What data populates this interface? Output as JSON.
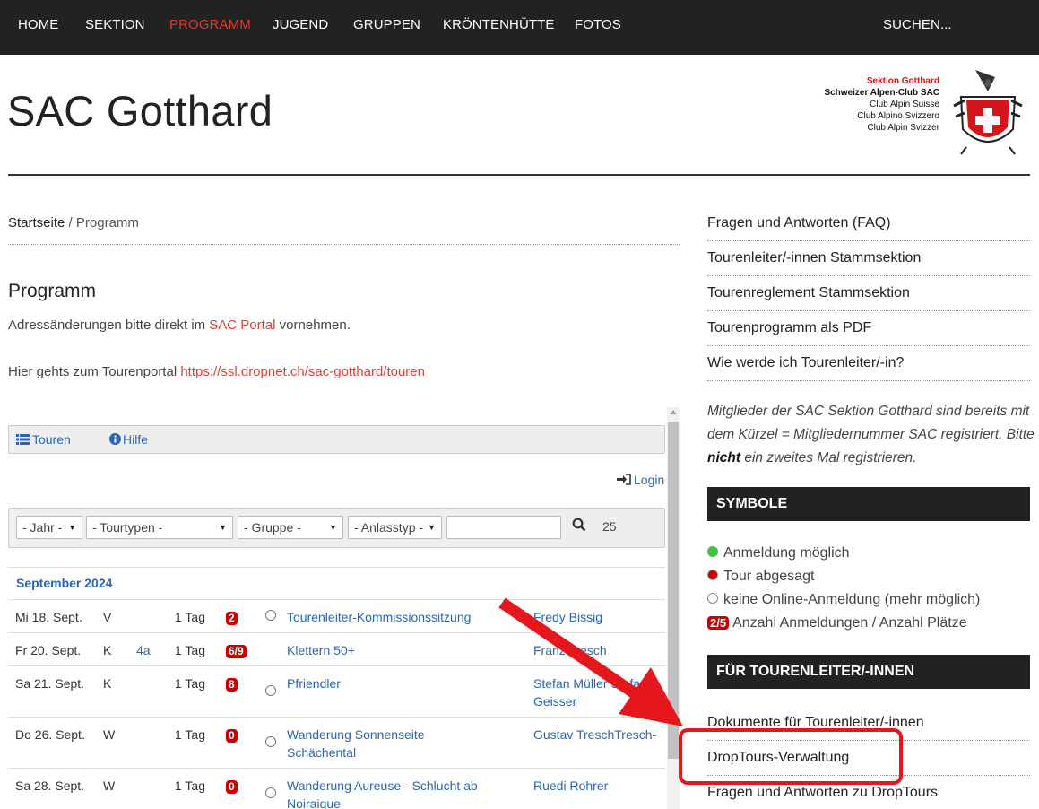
{
  "nav": {
    "items": [
      "HOME",
      "SEKTION",
      "PROGRAMM",
      "JUGEND",
      "GRUPPEN",
      "KRÖNTENHÜTTE",
      "FOTOS"
    ],
    "search": "SUCHEN..."
  },
  "header": {
    "title": "SAC Gotthard",
    "logo_lines": [
      "Sektion Gotthard",
      "Schweizer Alpen-Club SAC",
      "Club Alpin Suisse",
      "Club Alpino Svizzero",
      "Club Alpin Svizzer"
    ]
  },
  "breadcrumb": {
    "home": "Startseite",
    "sep": " / ",
    "current": "Programm"
  },
  "main": {
    "title": "Programm",
    "intro1_pre": "Adressänderungen bitte direkt im ",
    "intro1_link": "SAC Portal",
    "intro1_post": " vornehmen.",
    "intro2_pre": "Hier gehts zum Tourenportal ",
    "intro2_link": "https://ssl.dropnet.ch/sac-gotthard/touren"
  },
  "widget": {
    "tab_tours": "Touren",
    "tab_help": "Hilfe",
    "login": "Login",
    "filters": [
      "- Jahr -",
      "- Tourtypen -",
      "- Gruppe -",
      "- Anlasstyp -"
    ],
    "count": "25",
    "month": "September 2024",
    "rows": [
      {
        "date": "Mi 18. Sept.",
        "type": "V",
        "grade": "",
        "dur": "1 Tag",
        "badge": "2",
        "title": "Tourenleiter-Kommissionssitzung",
        "title2": "",
        "leader": "Fredy Bissig",
        "leader2": ""
      },
      {
        "date": "Fr 20. Sept.",
        "type": "K",
        "grade": "4a",
        "dur": "1 Tag",
        "badge": "6/9",
        "title": "Klettern 50+",
        "title2": "",
        "leader": "Franz Tresch",
        "leader2": ""
      },
      {
        "date": "Sa 21. Sept.",
        "type": "K",
        "grade": "",
        "dur": "1 Tag",
        "badge": "8",
        "title": "Pfriendler",
        "title2": "",
        "leader": "Stefan Müller Stefan",
        "leader2": "Geisser"
      },
      {
        "date": "Do 26. Sept.",
        "type": "W",
        "grade": "",
        "dur": "1 Tag",
        "badge": "0",
        "title": "Wanderung Sonnenseite",
        "title2": "Schächental",
        "leader": "Gustav TreschTresch-",
        "leader2": ""
      },
      {
        "date": "Sa 28. Sept.",
        "type": "W",
        "grade": "",
        "dur": "1 Tag",
        "badge": "0",
        "title": "Wanderung Aureuse - Schlucht ab",
        "title2": "Noiraigue",
        "leader": "Ruedi Rohrer",
        "leader2": ""
      }
    ]
  },
  "sidebar": {
    "links": [
      "Fragen und Antworten (FAQ)",
      "Tourenleiter/-innen Stammsektion",
      "Tourenreglement Stammsektion",
      "Tourenprogramm als PDF",
      "Wie werde ich Tourenleiter/-in?"
    ],
    "note_pre": "Mitglieder der SAC Sektion Gotthard sind bereits mit dem Kürzel = Mitgliedernummer SAC registriert. Bitte ",
    "note_bold": "nicht",
    "note_post": " ein zweites Mal registrieren.",
    "symbols_title": "SYMBOLE",
    "symbols": [
      "Anmeldung möglich",
      "Tour abgesagt",
      "keine Online-Anmeldung (mehr möglich)"
    ],
    "symbol_badge": "2/5",
    "symbol_badge_label": "Anzahl Anmeldungen / Anzahl Plätze",
    "leaders_title": "FÜR TOURENLEITER/-INNEN",
    "leader_links": [
      "Dokumente für Tourenleiter/-innen",
      "DropTours-Verwaltung",
      "Fragen und Antworten zu DropTours"
    ]
  }
}
